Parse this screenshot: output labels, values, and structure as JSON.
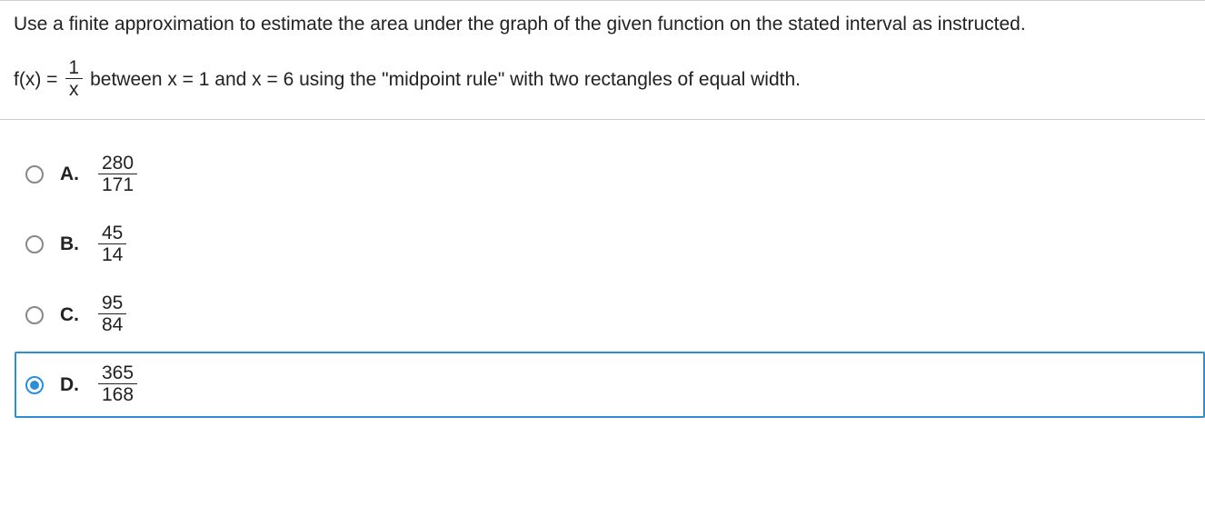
{
  "question": {
    "prompt": "Use a finite approximation to estimate the area under the graph of the given function on the stated interval as instructed.",
    "fx_prefix": "f(x) =",
    "fx_frac_num": "1",
    "fx_frac_den": "x",
    "fx_suffix": "between x = 1 and x = 6 using the \"midpoint rule\" with two rectangles of equal width."
  },
  "options": [
    {
      "label": "A.",
      "num": "280",
      "den": "171",
      "selected": false
    },
    {
      "label": "B.",
      "num": "45",
      "den": "14",
      "selected": false
    },
    {
      "label": "C.",
      "num": "95",
      "den": "84",
      "selected": false
    },
    {
      "label": "D.",
      "num": "365",
      "den": "168",
      "selected": true
    }
  ]
}
